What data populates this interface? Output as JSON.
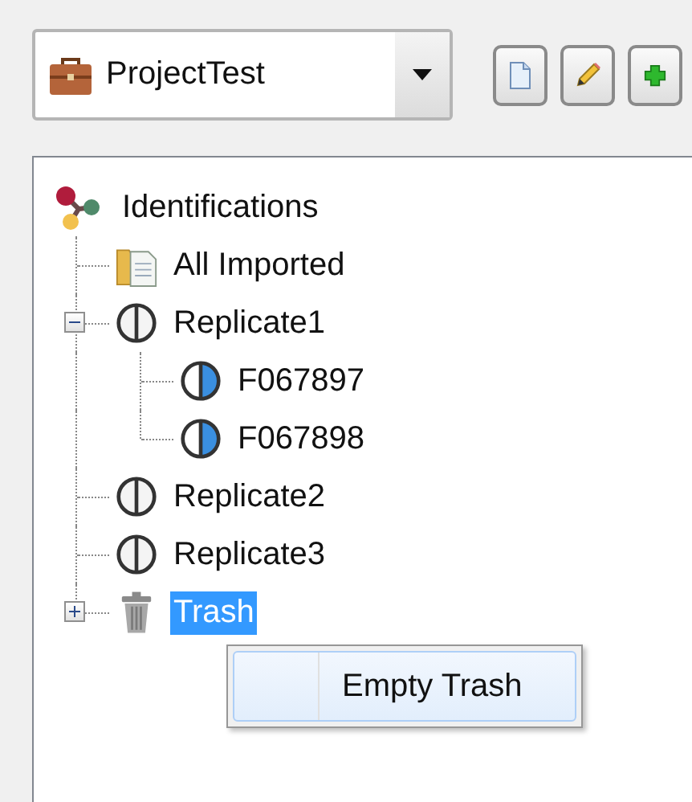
{
  "project_select": {
    "value": "ProjectTest"
  },
  "tree": {
    "label": "Identifications",
    "kind": "root",
    "selected": false,
    "children": [
      {
        "label": "All Imported",
        "kind": "folder",
        "selected": false
      },
      {
        "label": "Replicate1",
        "kind": "replicate",
        "selected": false,
        "expanded": true,
        "children": [
          {
            "label": "F067897",
            "kind": "sample",
            "selected": false
          },
          {
            "label": "F067898",
            "kind": "sample",
            "selected": false
          }
        ]
      },
      {
        "label": "Replicate2",
        "kind": "replicate",
        "selected": false
      },
      {
        "label": "Replicate3",
        "kind": "replicate",
        "selected": false
      },
      {
        "label": "Trash",
        "kind": "trash",
        "selected": true,
        "expanded": false
      }
    ]
  },
  "context_menu": {
    "items": [
      {
        "label": "Empty Trash",
        "selected": true
      }
    ]
  }
}
